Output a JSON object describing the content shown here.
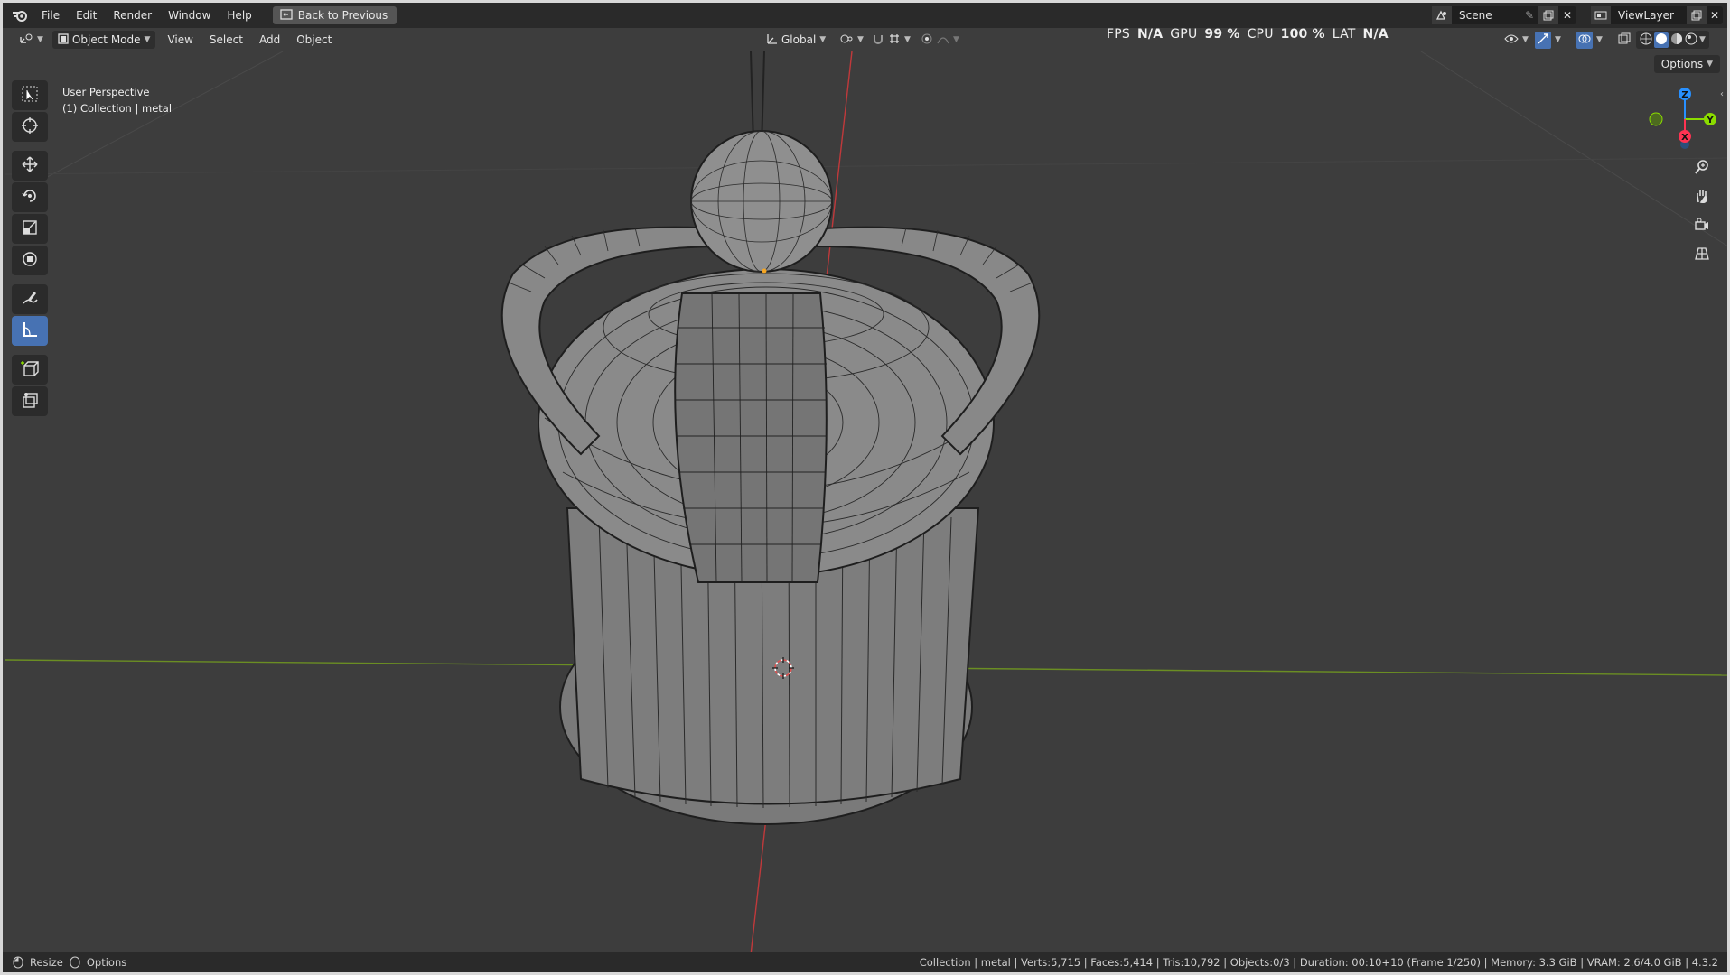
{
  "menu": {
    "items": [
      "File",
      "Edit",
      "Render",
      "Window",
      "Help"
    ],
    "back_button": "Back to Previous"
  },
  "scene": {
    "name": "Scene"
  },
  "view_layer": {
    "name": "ViewLayer"
  },
  "header": {
    "mode": "Object Mode",
    "menus": [
      "View",
      "Select",
      "Add",
      "Object"
    ],
    "transform_orientation": "Global",
    "options": "Options"
  },
  "stats": {
    "fps_label": "FPS",
    "fps_value": "N/A",
    "gpu_label": "GPU",
    "gpu_value": "99 %",
    "cpu_label": "CPU",
    "cpu_value": "100 %",
    "lat_label": "LAT",
    "lat_value": "N/A"
  },
  "viewport": {
    "perspective": "User Perspective",
    "collection": "(1) Collection | metal"
  },
  "gizmo": {
    "z": "Z",
    "y": "Y",
    "x": "X"
  },
  "statusbar": {
    "resize": "Resize",
    "options": "Options",
    "info": "Collection | metal | Verts:5,715 | Faces:5,414 | Tris:10,792 | Objects:0/3 | Duration: 00:10+10 (Frame 1/250) | Memory: 3.3 GiB | VRAM: 2.6/4.0 GiB | 4.3.2"
  },
  "colors": {
    "accent": "#4772b3",
    "axis_x": "#ff3352",
    "axis_y": "#8bdc00",
    "axis_z": "#2890ff",
    "background": "#3d3d3d"
  }
}
